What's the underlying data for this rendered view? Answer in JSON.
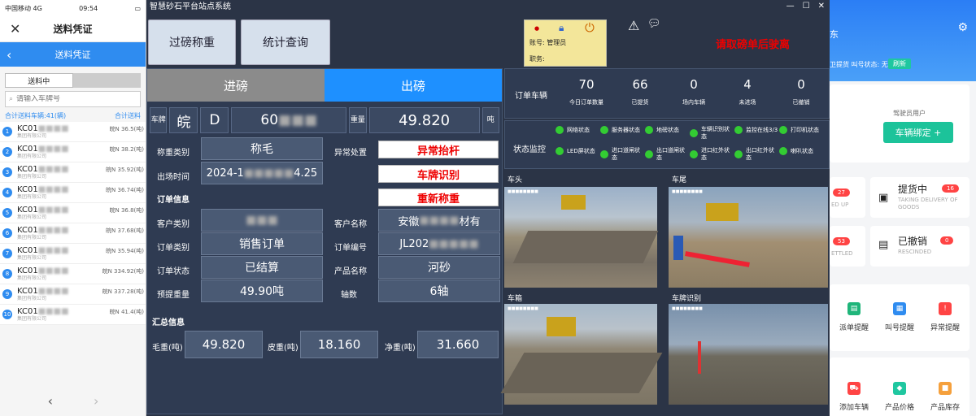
{
  "phone": {
    "carrier": "中国移动",
    "network": "4G",
    "time": "09:54",
    "title": "送料凭证",
    "subtitle": "送料凭证",
    "tab_active": "送料中",
    "search_placeholder": "请输入车牌号",
    "summary_left": "合计送料车辆:41(辆)",
    "summary_right": "合计送料",
    "rows": [
      {
        "num": "1",
        "code": "KC01",
        "weight": "皖N    36.5(吨)",
        "company": "    集团有限公司"
      },
      {
        "num": "2",
        "code": "KC01",
        "weight": "皖N    38.2(吨)",
        "company": "    集团有限公司"
      },
      {
        "num": "3",
        "code": "KC01",
        "weight": "皖N    35.92(吨)",
        "company": "    集团有限公司"
      },
      {
        "num": "4",
        "code": "KC01",
        "weight": "皖N    36.74(吨)",
        "company": "    集团有限公司"
      },
      {
        "num": "5",
        "code": "KC01",
        "weight": "皖N    36.8(吨)",
        "company": "    集团有限公司"
      },
      {
        "num": "6",
        "code": "KC01",
        "weight": "皖N    37.68(吨)",
        "company": "    集团有限公司"
      },
      {
        "num": "7",
        "code": "KC01",
        "weight": "皖N    35.94(吨)",
        "company": "    集团有限公司"
      },
      {
        "num": "8",
        "code": "KC01",
        "weight": "皖N    334.92(吨)",
        "company": "    集团有限公司"
      },
      {
        "num": "9",
        "code": "KC01",
        "weight": "皖N    337.28(吨)",
        "company": "    集团有限公司"
      },
      {
        "num": "10",
        "code": "KC01",
        "weight": "皖N    41.4(吨)",
        "company": "    集团有限公司"
      }
    ]
  },
  "window": {
    "title": "智慧砂石平台站点系统",
    "btn_weigh": "过磅称重",
    "btn_stats": "统计查询",
    "account_label": "账号:",
    "account_value": "管理员",
    "position_label": "职务:",
    "notice": "请取磅单后驶离",
    "tab_in": "进磅",
    "tab_out": "出磅"
  },
  "weigh": {
    "plate_label": "车牌",
    "province": "皖",
    "letter": "D",
    "plate_num": "60",
    "weight_label": "重量",
    "weight": "49.820",
    "unit": "吨",
    "type_label": "称重类别",
    "type_value": "称毛",
    "exit_time_label": "出场时间",
    "exit_time": "2024-1",
    "exit_time_end": "4.25",
    "exception_label": "异常处置",
    "btn_raise": "异常抬杆",
    "btn_plate": "车牌识别",
    "btn_reweigh": "重新称重",
    "order_section": "订单信息",
    "customer_type_label": "客户类别",
    "customer_type": "",
    "customer_name_label": "客户名称",
    "customer_name": "安徽",
    "customer_name_end": "材有",
    "order_type_label": "订单类别",
    "order_type": "销售订单",
    "order_no_label": "订单编号",
    "order_no": "JL202",
    "order_status_label": "订单状态",
    "order_status": "已结算",
    "product_label": "产品名称",
    "product": "河砂",
    "expected_label": "预提重量",
    "expected": "49.90吨",
    "axles_label": "轴数",
    "axles": "6轴",
    "summary_section": "汇总信息",
    "gross_label": "毛重(吨)",
    "gross": "49.820",
    "tare_label": "皮重(吨)",
    "tare": "18.160",
    "net_label": "净重(吨)",
    "net": "31.660"
  },
  "stats": {
    "head": "订单车辆",
    "items": [
      {
        "value": "70",
        "label": "今日订单数量"
      },
      {
        "value": "66",
        "label": "已提货"
      },
      {
        "value": "0",
        "label": "场内车辆"
      },
      {
        "value": "4",
        "label": "未进场"
      },
      {
        "value": "0",
        "label": "已撤销"
      }
    ]
  },
  "monitor": {
    "head": "状态监控",
    "dots": [
      "网络状态",
      "服务器状态",
      "地磅状态",
      "车辆识别状态",
      "监控在线3/3",
      "打印机状态",
      "LED屏状态",
      "进口道闸状态",
      "出口道闸状态",
      "进口红外状态",
      "出口红外状态",
      "喇叭状态"
    ],
    "status_color": "#33cc33"
  },
  "cameras": {
    "head": "车头",
    "tail": "车尾",
    "box": "车箱",
    "plate": "车牌识别"
  },
  "rphone": {
    "name": "东",
    "status_prefix": "卫提货  叫号状态: 无",
    "refresh": "刷新",
    "role": "驾驶员用户",
    "bind": "车辆绑定 +",
    "pick_title": "提货中",
    "pick_count": "16",
    "pick_en": "TAKING DELIVERY OF GOODS",
    "left1_count": "27",
    "left1_en": "ED UP",
    "cancel_title": "已撤销",
    "cancel_count": "0",
    "cancel_en": "RESCINDED",
    "left2_count": "53",
    "left2_en": "ETTLED",
    "menu": [
      "派单提醒",
      "叫号提醒",
      "异常提醒",
      "添加车辆",
      "产品价格",
      "产品库存"
    ]
  }
}
